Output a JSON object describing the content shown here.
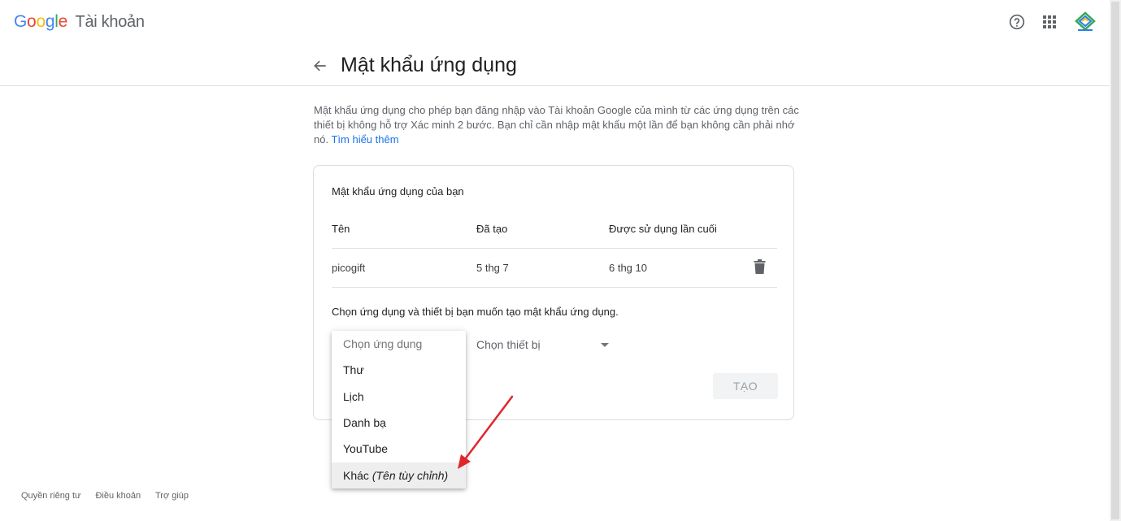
{
  "header": {
    "logo_text": "Google",
    "product_name": "Tài khoản",
    "help_icon": "help-circle-icon",
    "apps_icon": "apps-grid-icon",
    "avatar_icon": "account-avatar-icon"
  },
  "title_bar": {
    "back_icon": "arrow-back-icon",
    "title": "Mật khẩu ứng dụng"
  },
  "intro": {
    "text": "Mật khẩu ứng dụng cho phép bạn đăng nhập vào Tài khoản Google của mình từ các ứng dụng trên các thiết bị không hỗ trợ Xác minh 2 bước. Bạn chỉ cần nhập mật khẩu một lần để bạn không cần phải nhớ nó.",
    "link_text": "Tìm hiểu thêm"
  },
  "card": {
    "heading": "Mật khẩu ứng dụng của bạn",
    "columns": [
      "Tên",
      "Đã tạo",
      "Được sử dụng lần cuối"
    ],
    "rows": [
      {
        "name": "picogift",
        "created": "5 thg 7",
        "last_used": "6 thg 10"
      }
    ],
    "create_heading": "Chọn ứng dụng và thiết bị bạn muốn tạo mật khẩu ứng dụng.",
    "device_select_label": "Chọn thiết bị",
    "create_button": "TẠO"
  },
  "app_dropdown": {
    "placeholder": "Chọn ứng dụng",
    "options": [
      "Thư",
      "Lịch",
      "Danh bạ",
      "YouTube"
    ],
    "custom_option_label": "Khác",
    "custom_option_hint": "(Tên tùy chỉnh)"
  },
  "annotation": {
    "arrow_color": "#e0262b"
  },
  "footer": {
    "links": [
      "Quyền riêng tư",
      "Điều khoản",
      "Trợ giúp"
    ]
  },
  "colors": {
    "link": "#1a73e8",
    "text_primary": "#202124",
    "text_secondary": "#5f6368",
    "divider": "#e0e0e0"
  }
}
